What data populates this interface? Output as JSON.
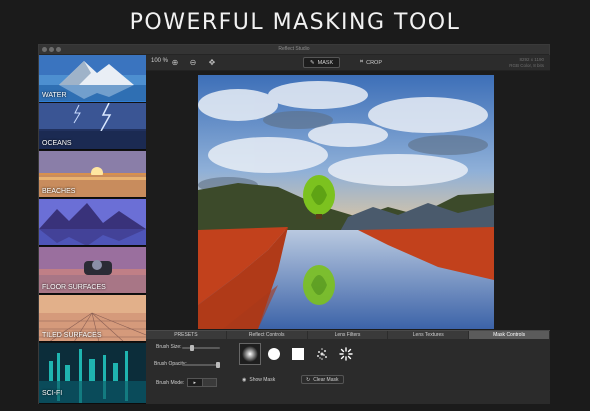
{
  "headline": "POWERFUL MASKING TOOL",
  "window": {
    "title": "Reflect Studio"
  },
  "sidebar": {
    "presets": [
      {
        "label": "WATER",
        "selected": true
      },
      {
        "label": "OCEANS",
        "selected": false
      },
      {
        "label": "BEACHES",
        "selected": false
      },
      {
        "label": "",
        "selected": false
      },
      {
        "label": "FLOOR SURFACES",
        "selected": false
      },
      {
        "label": "TILED SURFACES",
        "selected": false
      },
      {
        "label": "SCI-FI",
        "selected": false
      }
    ]
  },
  "toolbar": {
    "zoom": "100 %",
    "mask_label": "MASK",
    "crop_label": "CROP",
    "info_line1": "8292 x 1190",
    "info_line2": "RGB Color, 8 bits"
  },
  "tabs": [
    "PRESETS",
    "Reflect Controls",
    "Lens Filters",
    "Lens Textures",
    "Mask Controls"
  ],
  "active_tab": "Mask Controls",
  "controls": {
    "brush_size_label": "Brush Size:",
    "brush_opacity_label": "Brush Opacity:",
    "brush_mode_label": "Brush Mode:",
    "show_mask_label": "Show Mask",
    "clear_mask_label": "Clear Mask",
    "brush_size_value": 0.25,
    "brush_opacity_value": 0.95
  },
  "colors": {
    "accent": "#2f7fd8",
    "mask_overlay": "#c2411c",
    "balloon": "#7cc21f"
  }
}
